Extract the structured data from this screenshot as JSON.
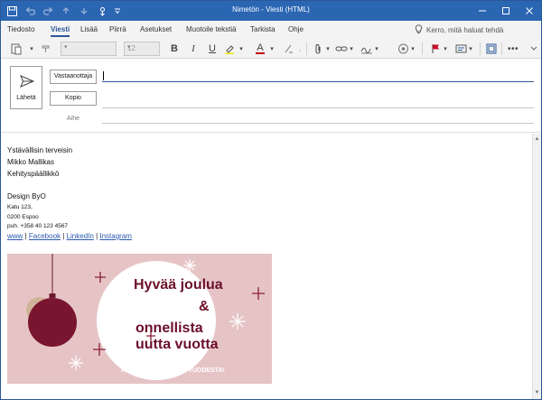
{
  "window": {
    "title": "Nimetön - Viesti (HTML)"
  },
  "colors": {
    "titlebar": "#2b66b3",
    "accent": "#2b579a",
    "card_bg": "#e6c4c6",
    "ornament": "#7a1530",
    "link": "#2a5ab0"
  },
  "icons": [
    "save-icon",
    "undo-icon",
    "redo-icon",
    "up-icon",
    "down-icon",
    "touch-mode-icon",
    "customize-icon",
    "lightbulb-icon",
    "paperclip-icon",
    "link-icon",
    "signature-icon",
    "sensitivity-icon",
    "flag-icon",
    "options-icon",
    "view-icon",
    "more-icon",
    "send-icon",
    "scroll-up-icon",
    "scroll-down-icon"
  ],
  "tabs": [
    "Tiedosto",
    "Viesti",
    "Lisää",
    "Piirrä",
    "Asetukset",
    "Muotoile tekstiä",
    "Tarkista",
    "Ohje"
  ],
  "active_tab": "Viesti",
  "tell_me": "Kerro, mitä haluat tehdä",
  "ribbon": {
    "font_size": "12",
    "bold": "B",
    "italic": "I",
    "underline": "U",
    "font_color": "A"
  },
  "compose": {
    "send_label": "Lähetä",
    "to_button": "Vastaanottaja",
    "cc_button": "Kopio",
    "subject_label": "Aihe",
    "to_value": ""
  },
  "signature": {
    "greeting": "Ystävällisin terveisin",
    "name": "Mikko Mallikas",
    "role": "Kehityspäällikkö",
    "company": "Design ByO",
    "street": "Katu 123,",
    "city": "0200 Espoo",
    "phone": "puh. +358 40 123 4567",
    "links": [
      "www",
      "Facebook",
      "LinkedIn",
      "Instagram"
    ],
    "separator": "|"
  },
  "card": {
    "line1": "Hyvää joulua",
    "amp": "&",
    "line2": "onnellista",
    "line3": "uutta vuotta",
    "footer": "KIITOS KULUNEESTA VUODESTA!"
  }
}
